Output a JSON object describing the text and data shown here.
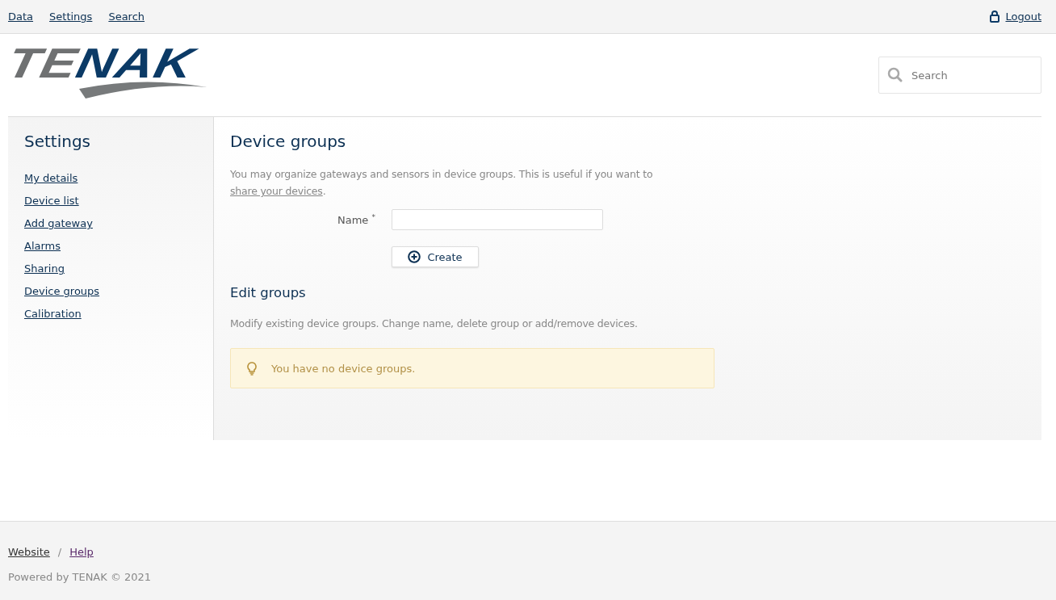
{
  "top_nav": {
    "links": [
      {
        "label": "Data"
      },
      {
        "label": "Settings"
      },
      {
        "label": "Search"
      }
    ],
    "logout": "Logout"
  },
  "logo": {
    "segments": [
      {
        "text": "TE",
        "color": "#6f7172"
      },
      {
        "text": "NAK",
        "color": "#0b3a66"
      }
    ]
  },
  "search": {
    "placeholder": "Search"
  },
  "sidebar": {
    "title": "Settings",
    "items": [
      {
        "label": "My details"
      },
      {
        "label": "Device list"
      },
      {
        "label": "Add gateway"
      },
      {
        "label": "Alarms"
      },
      {
        "label": "Sharing"
      },
      {
        "label": "Device groups"
      },
      {
        "label": "Calibration"
      }
    ]
  },
  "content": {
    "title": "Device groups",
    "intro": "You may organize gateways and sensors in device groups. This is useful if you want to ",
    "intro_link": "share your devices",
    "intro_end": ".",
    "name_label": "Name",
    "required_mark": "*",
    "create_button": "Create",
    "edit_title": "Edit groups",
    "edit_text": "Modify existing device groups. Change name, delete group or add/remove devices.",
    "notice": "You have no device groups."
  },
  "footer": {
    "links": [
      {
        "label": "Website",
        "visited": false
      },
      {
        "label": "Help",
        "visited": true
      }
    ],
    "separator": "/",
    "powered": "Powered by TENAK © 2021"
  }
}
